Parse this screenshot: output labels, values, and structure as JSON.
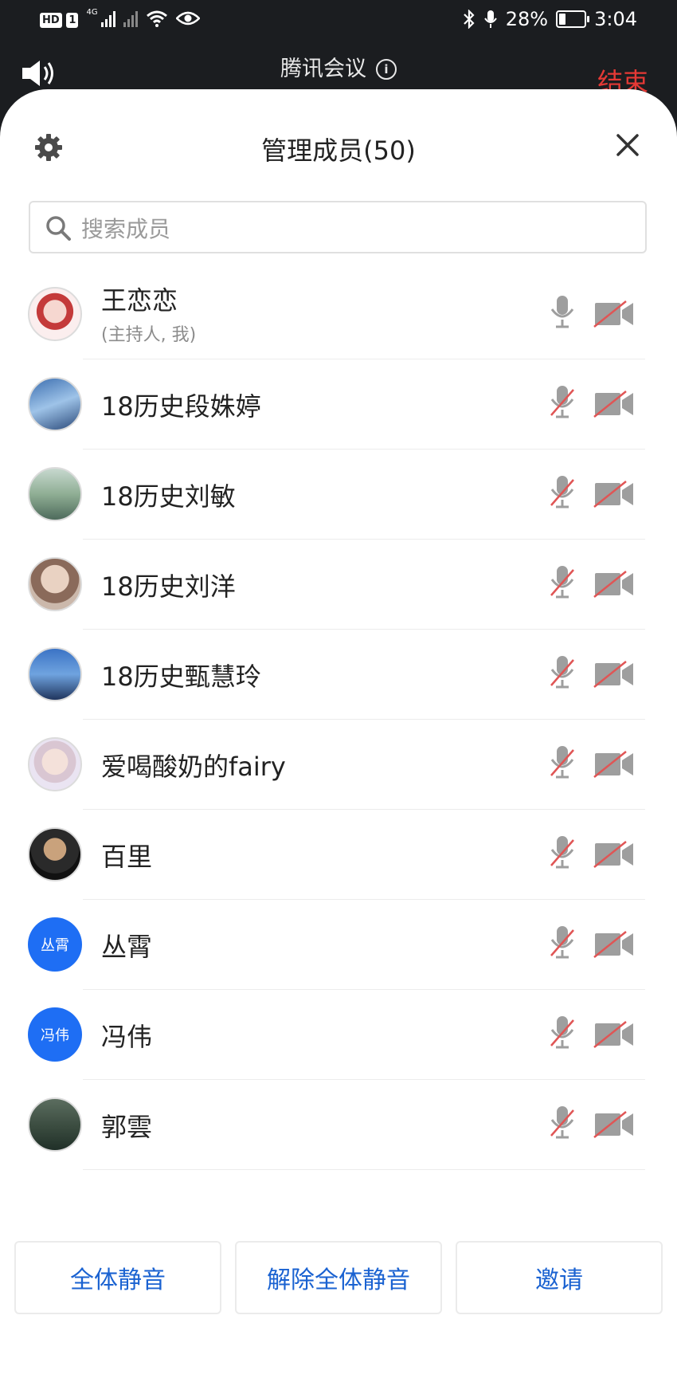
{
  "status_bar": {
    "hd_label": "HD",
    "sim_label": "1",
    "network_label": "4G",
    "battery_percent": "28%",
    "battery_level": 0.28,
    "time": "3:04"
  },
  "meeting_bar": {
    "app_title": "腾讯会议",
    "info_icon": "info-icon",
    "end_label": "结束"
  },
  "sheet": {
    "title": "管理成员(50)",
    "settings_icon": "gear-icon",
    "close_icon": "close-icon"
  },
  "search": {
    "placeholder": "搜索成员"
  },
  "members": [
    {
      "name": "王恋恋",
      "subtitle": "(主持人, 我)",
      "avatar": "photo",
      "mic_muted": false,
      "camera_off": true
    },
    {
      "name": "18历史段姝婷",
      "avatar": "photo",
      "mic_muted": true,
      "camera_off": true
    },
    {
      "name": "18历史刘敏",
      "avatar": "photo",
      "mic_muted": true,
      "camera_off": true
    },
    {
      "name": "18历史刘洋",
      "avatar": "photo",
      "mic_muted": true,
      "camera_off": true
    },
    {
      "name": "18历史甄慧玲",
      "avatar": "photo",
      "mic_muted": true,
      "camera_off": true
    },
    {
      "name": "爱喝酸奶的fairy",
      "avatar": "photo",
      "mic_muted": true,
      "camera_off": true
    },
    {
      "name": "百里",
      "avatar": "photo",
      "mic_muted": true,
      "camera_off": true
    },
    {
      "name": "丛霄",
      "avatar_text": "丛霄",
      "mic_muted": true,
      "camera_off": true
    },
    {
      "name": "冯伟",
      "avatar_text": "冯伟",
      "mic_muted": true,
      "camera_off": true
    },
    {
      "name": "郭雲",
      "avatar": "photo",
      "mic_muted": true,
      "camera_off": true
    }
  ],
  "footer": {
    "mute_all_label": "全体静音",
    "unmute_all_label": "解除全体静音",
    "invite_label": "邀请"
  },
  "colors": {
    "accent_blue": "#1a62d1",
    "avatar_blue": "#1e6ef4",
    "end_red": "#e53935",
    "muted_slash": "#e05555",
    "icon_gray": "#9e9e9e"
  }
}
